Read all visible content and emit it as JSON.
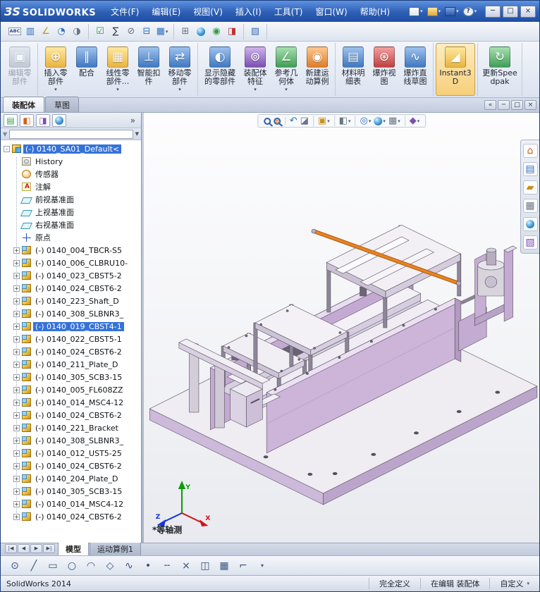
{
  "palette": {
    "titlebar_blue": "#2d5fb5",
    "selection_blue": "#3572d8",
    "model_lavender": "#cdb5da",
    "rod_orange": "#e8821e"
  },
  "titlebar": {
    "logo_prefix": "ЗS",
    "logo_text": "SOLIDWORKS",
    "menus": [
      {
        "name": "menu-file",
        "label": "文件(F)"
      },
      {
        "name": "menu-edit",
        "label": "编辑(E)"
      },
      {
        "name": "menu-view",
        "label": "视图(V)"
      },
      {
        "name": "menu-insert",
        "label": "插入(I)"
      },
      {
        "name": "menu-tools",
        "label": "工具(T)"
      },
      {
        "name": "menu-window",
        "label": "窗口(W)"
      },
      {
        "name": "menu-help",
        "label": "帮助(H)"
      }
    ],
    "quick": [
      {
        "name": "new-document-button",
        "cls": "qi-new",
        "glyph": "",
        "arrow": true
      },
      {
        "name": "open-document-button",
        "cls": "qi-open",
        "glyph": "",
        "arrow": true
      },
      {
        "name": "save-button",
        "cls": "qi-save",
        "glyph": "",
        "arrow": true
      },
      {
        "name": "help-button",
        "cls": "qi-help",
        "glyph": "?",
        "arrow": true
      }
    ],
    "window_buttons": [
      {
        "name": "minimize-button",
        "glyph": "─"
      },
      {
        "name": "maximize-button",
        "glyph": "□"
      },
      {
        "name": "close-button",
        "glyph": "×"
      }
    ]
  },
  "toolbar": {
    "groups": [
      [
        {
          "name": "spell-checker-button",
          "glyph": "ABC",
          "cls": "txt"
        },
        {
          "name": "compare-documents-button",
          "glyph": "▥",
          "cls": "blu"
        },
        {
          "name": "measure-button",
          "glyph": "∠",
          "cls": "yel"
        },
        {
          "name": "mass-properties-button",
          "glyph": "◔",
          "cls": "blu"
        },
        {
          "name": "section-properties-button",
          "glyph": "◑",
          "cls": "gry"
        }
      ],
      [
        {
          "name": "check-document-button",
          "glyph": "☑",
          "cls": "grn"
        },
        {
          "name": "equations-button",
          "glyph": "∑",
          "cls": "dk"
        },
        {
          "name": "no-external-references-button",
          "glyph": "⊘",
          "cls": "gry"
        },
        {
          "name": "external-references-button",
          "glyph": "⊟",
          "cls": "blu"
        },
        {
          "name": "design-table-button",
          "glyph": "▦",
          "cls": "blu",
          "arrow": true
        }
      ],
      [
        {
          "name": "tools-options-button",
          "glyph": "⊞",
          "cls": "gry"
        },
        {
          "name": "appearances-button",
          "glyph": "",
          "cls": "orb-ic"
        },
        {
          "name": "design-checker-button",
          "glyph": "◉",
          "cls": "grn"
        },
        {
          "name": "compare-results-button",
          "glyph": "◨",
          "cls": "red"
        }
      ],
      [
        {
          "name": "addins-button",
          "glyph": "▧",
          "cls": "blu"
        }
      ]
    ]
  },
  "ribbon": {
    "groups": [
      [
        {
          "name": "edit-component-button",
          "label": "编辑零部件",
          "glyph": "▣",
          "cls": "cgr disabled"
        }
      ],
      [
        {
          "name": "insert-components-button",
          "label": "插入零部件",
          "glyph": "⊕",
          "cls": "cy",
          "arrow": true
        },
        {
          "name": "mate-button",
          "label": "配合",
          "glyph": "∥",
          "cls": "cb"
        },
        {
          "name": "linear-component-pattern-button",
          "label": "线性零部件...",
          "glyph": "▦",
          "cls": "cy",
          "arrow": true
        },
        {
          "name": "smart-fasteners-button",
          "label": "智能扣件",
          "glyph": "⊥",
          "cls": "cb"
        },
        {
          "name": "move-component-button",
          "label": "移动零部件",
          "glyph": "⇄",
          "cls": "cb",
          "arrow": true
        }
      ],
      [
        {
          "name": "show-hidden-components-button",
          "label": "显示隐藏的零部件",
          "glyph": "◐",
          "cls": "cb wide"
        },
        {
          "name": "assembly-features-button",
          "label": "装配体特征",
          "glyph": "⊚",
          "cls": "cp",
          "arrow": true
        },
        {
          "name": "reference-geometry-button",
          "label": "参考几何体",
          "glyph": "∠",
          "cls": "cg",
          "arrow": true
        },
        {
          "name": "new-motion-study-button",
          "label": "新建运动算例",
          "glyph": "◉",
          "cls": "co"
        }
      ],
      [
        {
          "name": "bill-of-materials-button",
          "label": "材料明细表",
          "glyph": "▤",
          "cls": "cb"
        },
        {
          "name": "exploded-view-button",
          "label": "爆炸视图",
          "glyph": "⊛",
          "cls": "cr"
        },
        {
          "name": "explode-line-sketch-button",
          "label": "爆炸直线草图",
          "glyph": "∿",
          "cls": "cb"
        }
      ],
      [
        {
          "name": "instant3d-button",
          "label": "Instant3D",
          "glyph": "◢",
          "cls": "cy active wide"
        }
      ],
      [
        {
          "name": "update-speedpak-button",
          "label": "更新Speedpak",
          "glyph": "↻",
          "cls": "cg wide"
        }
      ]
    ]
  },
  "manager_tabs": {
    "tabs": [
      {
        "name": "tab-assembly",
        "label": "装配体",
        "cls": "active"
      },
      {
        "name": "tab-sketch",
        "label": "草图"
      }
    ],
    "doc_controls": [
      {
        "name": "collapse-pane-button",
        "glyph": "«"
      },
      {
        "name": "doc-minimize-button",
        "glyph": "─"
      },
      {
        "name": "doc-restore-button",
        "glyph": "□"
      },
      {
        "name": "doc-close-button",
        "glyph": "×"
      }
    ]
  },
  "panel": {
    "chevron": "»",
    "filter_placeholder": "",
    "tabs": [
      {
        "name": "featuremanager-tree-tab",
        "glyph": "▤",
        "cls": "grn"
      },
      {
        "name": "propertymanager-tab",
        "glyph": "◧",
        "cls": "org"
      },
      {
        "name": "configurationmanager-tab",
        "glyph": "◨",
        "cls": "pur"
      },
      {
        "name": "appearances-tab",
        "glyph": "",
        "cls": "orb-ic"
      }
    ]
  },
  "tree": {
    "items": [
      {
        "name": "tree-root-assembly",
        "label": "(-) 0140_SA01_Default<",
        "cls": "root ico-asm sel exp-minus"
      },
      {
        "name": "tree-item-history",
        "label": "History",
        "cls": "ico-history noexp"
      },
      {
        "name": "tree-item-sensors",
        "label": "传感器",
        "cls": "ico-sensor noexp"
      },
      {
        "name": "tree-item-annotations",
        "label": "注解",
        "cls": "ico-ann noexp"
      },
      {
        "name": "tree-item-front-plane",
        "label": "前视基准面",
        "cls": "ico-plane noexp"
      },
      {
        "name": "tree-item-top-plane",
        "label": "上视基准面",
        "cls": "ico-plane noexp"
      },
      {
        "name": "tree-item-right-plane",
        "label": "右视基准面",
        "cls": "ico-plane noexp"
      },
      {
        "name": "tree-item-origin",
        "label": "原点",
        "cls": "ico-origin noexp"
      },
      {
        "name": "tree-item-component",
        "label": "(-) 0140_004_TBCR-S5",
        "cls": "ico-part exp-plus"
      },
      {
        "name": "tree-item-component",
        "label": "(-) 0140_006_CLBRU10-",
        "cls": "ico-part exp-plus"
      },
      {
        "name": "tree-item-component",
        "label": "(-) 0140_023_CBST5-2",
        "cls": "ico-part exp-plus"
      },
      {
        "name": "tree-item-component",
        "label": "(-) 0140_024_CBST6-2",
        "cls": "ico-part exp-plus"
      },
      {
        "name": "tree-item-component",
        "label": "(-) 0140_223_Shaft_D",
        "cls": "ico-part exp-plus"
      },
      {
        "name": "tree-item-component",
        "label": "(-) 0140_308_SLBNR3_",
        "cls": "ico-part exp-plus"
      },
      {
        "name": "tree-item-component",
        "label": "(-) 0140_019_CBST4-1",
        "cls": "ico-part exp-plus sel"
      },
      {
        "name": "tree-item-component",
        "label": "(-) 0140_022_CBST5-1",
        "cls": "ico-part exp-plus"
      },
      {
        "name": "tree-item-component",
        "label": "(-) 0140_024_CBST6-2",
        "cls": "ico-part exp-plus"
      },
      {
        "name": "tree-item-component",
        "label": "(-) 0140_211_Plate_D",
        "cls": "ico-part exp-plus"
      },
      {
        "name": "tree-item-component",
        "label": "(-) 0140_305_SCB3-15",
        "cls": "ico-part exp-plus"
      },
      {
        "name": "tree-item-component",
        "label": "(-) 0140_005_FL608ZZ",
        "cls": "ico-part exp-plus"
      },
      {
        "name": "tree-item-component",
        "label": "(-) 0140_014_MSC4-12",
        "cls": "ico-part exp-plus"
      },
      {
        "name": "tree-item-component",
        "label": "(-) 0140_024_CBST6-2",
        "cls": "ico-part exp-plus"
      },
      {
        "name": "tree-item-component",
        "label": "(-) 0140_221_Bracket",
        "cls": "ico-part exp-plus"
      },
      {
        "name": "tree-item-component",
        "label": "(-) 0140_308_SLBNR3_",
        "cls": "ico-part exp-plus"
      },
      {
        "name": "tree-item-component",
        "label": "(-) 0140_012_UST5-25",
        "cls": "ico-part exp-plus"
      },
      {
        "name": "tree-item-component",
        "label": "(-) 0140_024_CBST6-2",
        "cls": "ico-part exp-plus"
      },
      {
        "name": "tree-item-component",
        "label": "(-) 0140_204_Plate_D",
        "cls": "ico-part exp-plus"
      },
      {
        "name": "tree-item-component",
        "label": "(-) 0140_305_SCB3-15",
        "cls": "ico-part exp-plus"
      },
      {
        "name": "tree-item-component",
        "label": "(-) 0140_014_MSC4-12",
        "cls": "ico-part exp-plus"
      },
      {
        "name": "tree-item-component",
        "label": "(-) 0140_024_CBST6-2",
        "cls": "ico-part exp-plus"
      }
    ]
  },
  "viewport": {
    "view_label": "*等轴测",
    "triad": {
      "x": "X",
      "y": "Y",
      "z": "Z"
    },
    "hud_groups": [
      [
        {
          "name": "zoom-to-fit-button",
          "glyph": "",
          "cls": "mag"
        },
        {
          "name": "zoom-to-area-button",
          "glyph": "",
          "cls": "mag magr"
        }
      ],
      [
        {
          "name": "previous-view-button",
          "glyph": "↶",
          "cls": "blu"
        },
        {
          "name": "section-view-button",
          "glyph": "◪",
          "cls": "gry"
        }
      ],
      [
        {
          "name": "view-orientation-button",
          "glyph": "▣",
          "cls": "yel",
          "arrow": true
        }
      ],
      [
        {
          "name": "display-style-button",
          "glyph": "◧",
          "cls": "gry",
          "arrow": true
        }
      ],
      [
        {
          "name": "hide-show-items-button",
          "glyph": "◎",
          "cls": "blu",
          "arrow": true
        },
        {
          "name": "edit-appearance-button",
          "glyph": "",
          "cls": "orb-ic",
          "arrow": true
        },
        {
          "name": "apply-scene-button",
          "glyph": "▦",
          "cls": "gry",
          "arrow": true
        }
      ],
      [
        {
          "name": "view-settings-button",
          "glyph": "◆",
          "cls": "pur",
          "arrow": true
        }
      ]
    ],
    "task_pane": [
      {
        "name": "solidworks-resources-tab",
        "glyph": "⌂",
        "cls": "org"
      },
      {
        "name": "design-library-tab",
        "glyph": "▤",
        "cls": "blu"
      },
      {
        "name": "file-explorer-tab",
        "glyph": "▰",
        "cls": "yel"
      },
      {
        "name": "view-palette-tab",
        "glyph": "▦",
        "cls": "gry"
      },
      {
        "name": "appearances-scenes-tab",
        "glyph": "",
        "cls": "orb-ic"
      },
      {
        "name": "custom-properties-tab",
        "glyph": "▧",
        "cls": "pur"
      }
    ]
  },
  "bottom": {
    "nav": [
      {
        "name": "first-tab-button",
        "glyph": "|◀"
      },
      {
        "name": "previous-tab-button",
        "glyph": "◀"
      },
      {
        "name": "next-tab-button",
        "glyph": "▶"
      },
      {
        "name": "last-tab-button",
        "glyph": "▶|"
      }
    ],
    "tabs": [
      {
        "name": "tab-model",
        "label": "模型",
        "cls": "active"
      },
      {
        "name": "tab-motion-study",
        "label": "运动算例1"
      }
    ]
  },
  "sketchbar": {
    "items": [
      {
        "name": "smart-dimension-button",
        "glyph": "⊙"
      },
      {
        "name": "line-button",
        "glyph": "╱"
      },
      {
        "name": "rectangle-button",
        "glyph": "▭"
      },
      {
        "name": "circle-button",
        "glyph": "○"
      },
      {
        "name": "arc-button",
        "glyph": "◠"
      },
      {
        "name": "polygon-button",
        "glyph": "◇"
      },
      {
        "name": "spline-button",
        "glyph": "∿"
      },
      {
        "name": "point-button",
        "glyph": "•"
      },
      {
        "name": "centerline-button",
        "glyph": "╌"
      },
      {
        "name": "trim-button",
        "glyph": "×"
      },
      {
        "name": "mirror-button",
        "glyph": "◫"
      },
      {
        "name": "linear-sketch-pattern-button",
        "glyph": "▦"
      },
      {
        "name": "fillet-button",
        "glyph": "⌐"
      },
      {
        "name": "sketch-flyout-button",
        "glyph": "▾",
        "cls": "arr"
      }
    ]
  },
  "statusbar": {
    "app": "SolidWorks 2014",
    "defined": "完全定义",
    "editing": "在编辑 装配体",
    "custom": "自定义"
  }
}
